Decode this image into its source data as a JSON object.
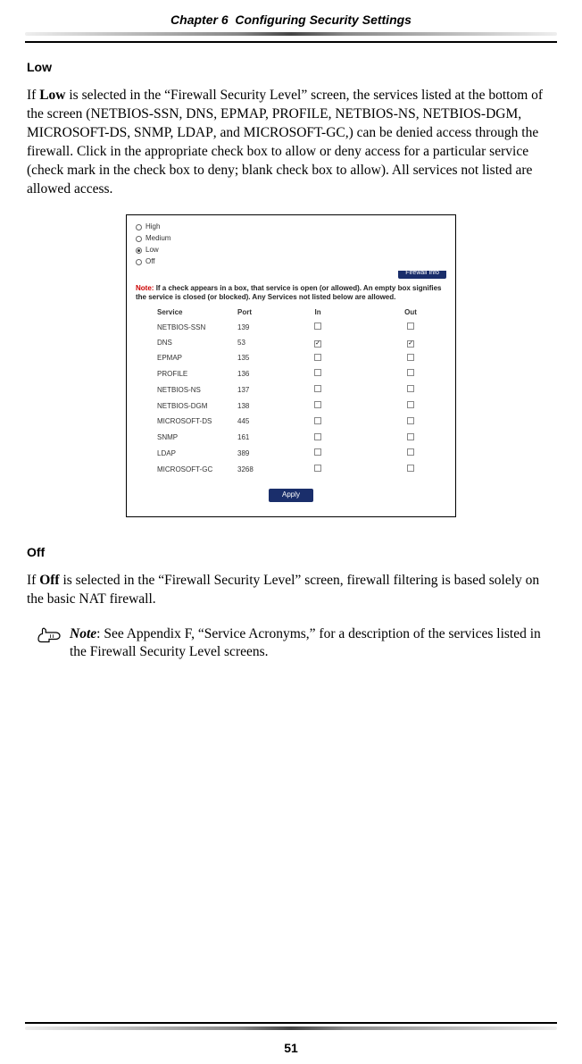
{
  "chapter": {
    "label": "Chapter 6",
    "title": "Configuring Security Settings"
  },
  "low": {
    "heading": "Low",
    "para_pre": "If ",
    "para_bold1": "Low",
    "para_mid1": " is selected in the “Firewall Security Level” screen, the services listed at the bottom of the screen (",
    "services_sc": "NETBIOS-SSN, DNS, EPMAP, PROFILE, NETBIOS-NS, NETBIOS-DGM, MICROSOFT-DS, SNMP, LDAP",
    "para_mid2": ", and ",
    "services_sc2": "MICROSOFT-GC",
    "para_mid3": ",) can be denied access through the firewall. Click in the appropriate check box to allow or deny access for a particular service (check mark in the check box to deny; blank check box to allow). All services not listed are allowed access."
  },
  "screenshot": {
    "radios": [
      "High",
      "Medium",
      "Low",
      "Off"
    ],
    "selected_radio": 2,
    "fwinfo": "Firewall Info",
    "note_label": "Note:",
    "note_body": "If a check appears in a box, that service is open (or allowed). An empty box signifies the service is closed (or blocked). Any Services not listed below are allowed.",
    "cols": {
      "service": "Service",
      "port": "Port",
      "in": "In",
      "out": "Out"
    },
    "rows": [
      {
        "service": "NETBIOS-SSN",
        "port": "139",
        "in": false,
        "out": false
      },
      {
        "service": "DNS",
        "port": "53",
        "in": true,
        "out": true
      },
      {
        "service": "EPMAP",
        "port": "135",
        "in": false,
        "out": false
      },
      {
        "service": "PROFILE",
        "port": "136",
        "in": false,
        "out": false
      },
      {
        "service": "NETBIOS-NS",
        "port": "137",
        "in": false,
        "out": false
      },
      {
        "service": "NETBIOS-DGM",
        "port": "138",
        "in": false,
        "out": false
      },
      {
        "service": "MICROSOFT-DS",
        "port": "445",
        "in": false,
        "out": false
      },
      {
        "service": "SNMP",
        "port": "161",
        "in": false,
        "out": false
      },
      {
        "service": "LDAP",
        "port": "389",
        "in": false,
        "out": false
      },
      {
        "service": "MICROSOFT-GC",
        "port": "3268",
        "in": false,
        "out": false
      }
    ],
    "apply": "Apply"
  },
  "off": {
    "heading": "Off",
    "para_pre": "If ",
    "para_bold": "Off",
    "para_mid": " is selected in the “Firewall Security Level” screen, firewall filtering is based solely on the basic ",
    "nat": "NAT",
    "para_end": " firewall."
  },
  "note": {
    "label": "Note",
    "body": ": See Appendix F, “Service Acronyms,” for a description of the services listed in the Firewall Security Level screens."
  },
  "page": "51"
}
